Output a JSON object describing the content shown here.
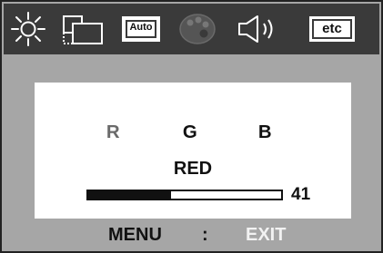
{
  "toolbar": {
    "icons": [
      {
        "name": "brightness-icon",
        "active": true
      },
      {
        "name": "position-icon",
        "active": true
      },
      {
        "name": "auto-adjust-icon",
        "label": "Auto",
        "active": true
      },
      {
        "name": "color-icon",
        "active": false
      },
      {
        "name": "volume-icon",
        "active": true
      },
      {
        "name": "etc-icon",
        "label": "etc",
        "active": true
      }
    ]
  },
  "panel": {
    "channels": [
      "R",
      "G",
      "B"
    ],
    "selected_channel": "R",
    "title": "RED",
    "level": {
      "value": "41",
      "fraction": 0.43
    }
  },
  "footer": {
    "menu_label": "MENU",
    "separator": ":",
    "exit_label": "EXIT"
  },
  "colors": {
    "osd_background": "#a6a6a6",
    "toolbar_background": "#3a3a3a",
    "panel_background": "#ffffff",
    "exit_text": "#f2f2f2"
  }
}
